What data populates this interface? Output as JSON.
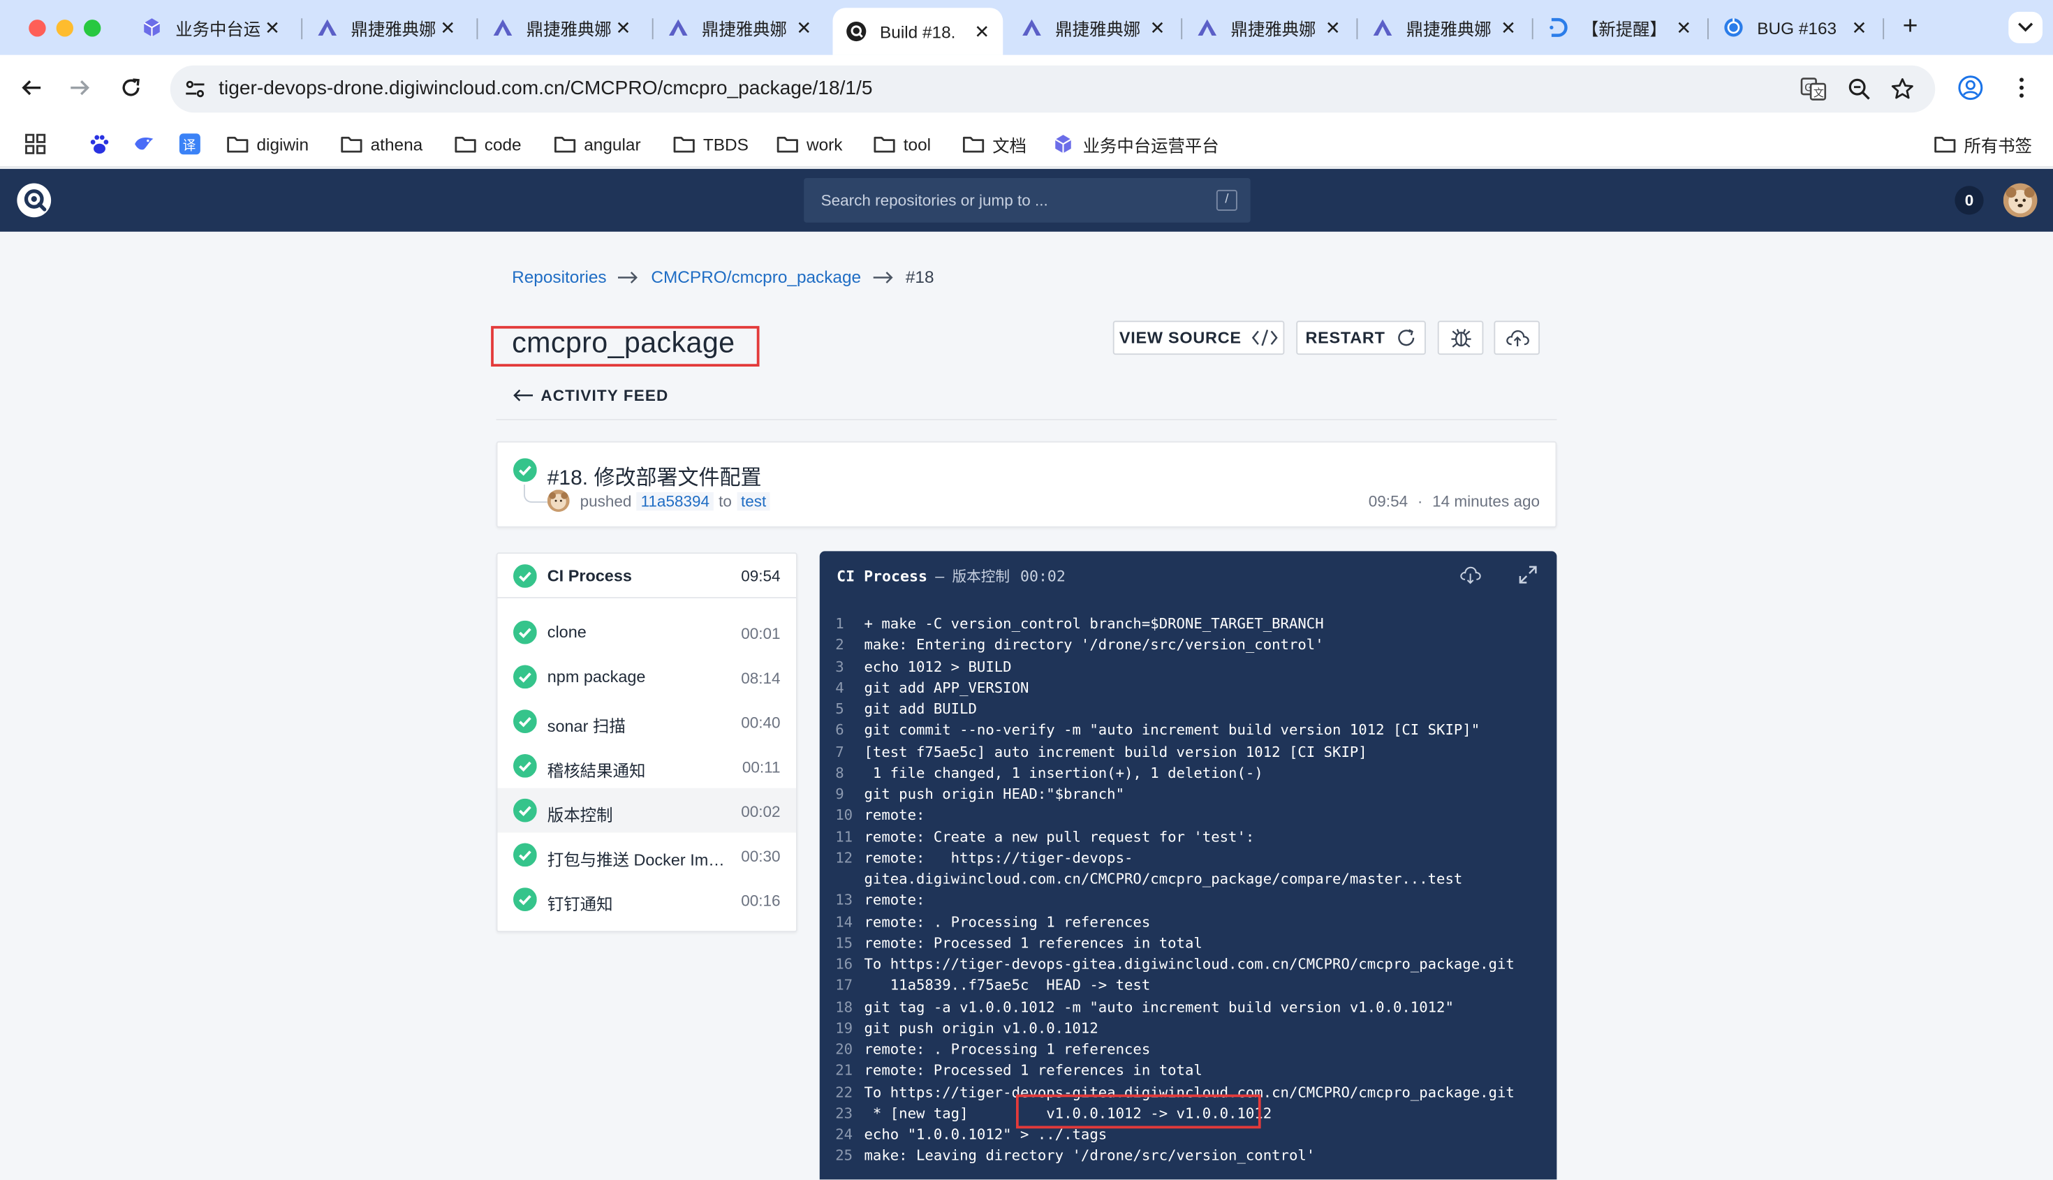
{
  "browser": {
    "tabs": [
      {
        "label": "业务中台运",
        "icon": "cube-icon",
        "color": "#6b6de8",
        "active": false
      },
      {
        "label": "鼎捷雅典娜",
        "icon": "athena-icon",
        "color": "#5b5fc7",
        "active": false
      },
      {
        "label": "鼎捷雅典娜",
        "icon": "athena-icon",
        "color": "#5b5fc7",
        "active": false
      },
      {
        "label": "鼎捷雅典娜",
        "icon": "athena-icon",
        "color": "#5b5fc7",
        "active": false
      },
      {
        "label": "Build #18.",
        "icon": "drone-icon",
        "color": "#1f1f1f",
        "active": true
      },
      {
        "label": "鼎捷雅典娜",
        "icon": "athena-icon",
        "color": "#5b5fc7",
        "active": false
      },
      {
        "label": "鼎捷雅典娜",
        "icon": "athena-icon",
        "color": "#5b5fc7",
        "active": false
      },
      {
        "label": "鼎捷雅典娜",
        "icon": "athena-icon",
        "color": "#5b5fc7",
        "active": false
      },
      {
        "label": "【新提醒】",
        "icon": "d-logo-icon",
        "color": "#2b7de9",
        "active": false
      },
      {
        "label": "BUG #163",
        "icon": "globe-icon",
        "color": "#2b7de9",
        "active": false
      }
    ],
    "url": "tiger-devops-drone.digiwincloud.com.cn/CMCPRO/cmcpro_package/18/1/5",
    "bookmarks": [
      {
        "label": "",
        "icon": "apps-grid-icon"
      },
      {
        "label": "",
        "icon": "baidu-paw-icon"
      },
      {
        "label": "",
        "icon": "bird-icon"
      },
      {
        "label": "",
        "icon": "translate-icon"
      },
      {
        "label": "digiwin",
        "icon": "folder-icon"
      },
      {
        "label": "athena",
        "icon": "folder-icon"
      },
      {
        "label": "code",
        "icon": "folder-icon"
      },
      {
        "label": "angular",
        "icon": "folder-icon"
      },
      {
        "label": "TBDS",
        "icon": "folder-icon"
      },
      {
        "label": "work",
        "icon": "folder-icon"
      },
      {
        "label": "tool",
        "icon": "folder-icon"
      },
      {
        "label": "文档",
        "icon": "folder-icon"
      },
      {
        "label": "业务中台运营平台",
        "icon": "cube-icon"
      }
    ],
    "all_bookmarks": "所有书签"
  },
  "drone": {
    "search_placeholder": "Search repositories or jump to ...",
    "search_shortcut": "/",
    "notification_count": "0",
    "breadcrumb": {
      "repositories": "Repositories",
      "repo": "CMCPRO/cmcpro_package",
      "build": "#18"
    },
    "repo_title": "cmcpro_package",
    "actions": {
      "view_source": "VIEW SOURCE",
      "restart": "RESTART"
    },
    "back_link": "ACTIVITY FEED",
    "commit": {
      "title": "#18. 修改部署文件配置",
      "action": "pushed",
      "hash": "11a58394",
      "to": "to",
      "branch": "test",
      "time": "09:54",
      "sep": "·",
      "ago": "14 minutes ago"
    },
    "stage": {
      "name": "CI Process",
      "time": "09:54",
      "steps": [
        {
          "name": "clone",
          "time": "00:01",
          "status": "success",
          "selected": false
        },
        {
          "name": "npm package",
          "time": "08:14",
          "status": "success",
          "selected": false
        },
        {
          "name": "sonar 扫描",
          "time": "00:40",
          "status": "success",
          "selected": false
        },
        {
          "name": "稽核結果通知",
          "time": "00:11",
          "status": "success",
          "selected": false
        },
        {
          "name": "版本控制",
          "time": "00:02",
          "status": "success",
          "selected": true
        },
        {
          "name": "打包与推送 Docker Image",
          "time": "00:30",
          "status": "success",
          "selected": false
        },
        {
          "name": "钉钉通知",
          "time": "00:16",
          "status": "success",
          "selected": false
        }
      ]
    },
    "log": {
      "stage": "CI Process",
      "dash": "—",
      "step": "版本控制",
      "time": "00:02",
      "lines": [
        {
          "n": "1",
          "t": "+ make -C version_control branch=$DRONE_TARGET_BRANCH"
        },
        {
          "n": "2",
          "t": "make: Entering directory '/drone/src/version_control'"
        },
        {
          "n": "3",
          "t": "echo 1012 > BUILD"
        },
        {
          "n": "4",
          "t": "git add APP_VERSION"
        },
        {
          "n": "5",
          "t": "git add BUILD"
        },
        {
          "n": "6",
          "t": "git commit --no-verify -m \"auto increment build version 1012 [CI SKIP]\""
        },
        {
          "n": "7",
          "t": "[test f75ae5c] auto increment build version 1012 [CI SKIP]"
        },
        {
          "n": "8",
          "t": " 1 file changed, 1 insertion(+), 1 deletion(-)"
        },
        {
          "n": "9",
          "t": "git push origin HEAD:\"$branch\""
        },
        {
          "n": "10",
          "t": "remote:"
        },
        {
          "n": "11",
          "t": "remote: Create a new pull request for 'test':"
        },
        {
          "n": "12",
          "t": "remote:   https://tiger-devops-"
        },
        {
          "n": "",
          "t": "gitea.digiwincloud.com.cn/CMCPRO/cmcpro_package/compare/master...test"
        },
        {
          "n": "13",
          "t": "remote:"
        },
        {
          "n": "14",
          "t": "remote: . Processing 1 references"
        },
        {
          "n": "15",
          "t": "remote: Processed 1 references in total"
        },
        {
          "n": "16",
          "t": "To https://tiger-devops-gitea.digiwincloud.com.cn/CMCPRO/cmcpro_package.git"
        },
        {
          "n": "17",
          "t": "   11a5839..f75ae5c  HEAD -> test"
        },
        {
          "n": "18",
          "t": "git tag -a v1.0.0.1012 -m \"auto increment build version v1.0.0.1012\""
        },
        {
          "n": "19",
          "t": "git push origin v1.0.0.1012"
        },
        {
          "n": "20",
          "t": "remote: . Processing 1 references"
        },
        {
          "n": "21",
          "t": "remote: Processed 1 references in total"
        },
        {
          "n": "22",
          "t": "To https://tiger-devops-gitea.digiwincloud.com.cn/CMCPRO/cmcpro_package.git"
        },
        {
          "n": "23",
          "t": " * [new tag]         v1.0.0.1012 -> v1.0.0.1012"
        },
        {
          "n": "24",
          "t": "echo \"1.0.0.1012\" > ../.tags"
        },
        {
          "n": "25",
          "t": "make: Leaving directory '/drone/src/version_control'"
        }
      ]
    }
  }
}
